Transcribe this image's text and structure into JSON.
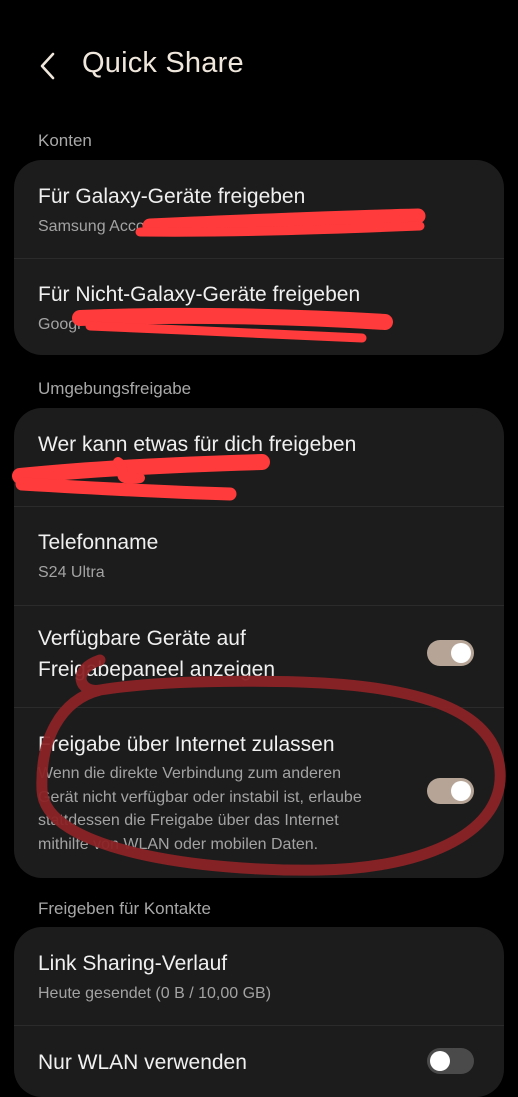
{
  "header": {
    "title": "Quick Share",
    "back_icon": "chevron-left-icon"
  },
  "sections": {
    "accounts": {
      "label": "Konten",
      "galaxy": {
        "title": "Für Galaxy-Geräte freigeben",
        "subtitle": "Samsung Acco"
      },
      "non_galaxy": {
        "title": "Für Nicht-Galaxy-Geräte freigeben",
        "subtitle": "Googl"
      }
    },
    "nearby": {
      "label": "Umgebungsfreigabe",
      "who": {
        "title": "Wer kann etwas für dich freigeben"
      },
      "phone_name": {
        "title": "Telefonname",
        "value": "S24 Ultra"
      },
      "show_devices": {
        "title_line1": "Verfügbare Geräte auf",
        "title_line2": "Freigabepaneel anzeigen",
        "toggle": "on"
      },
      "internet": {
        "title": "Freigabe über Internet zulassen",
        "desc_line1": "Wenn die direkte Verbindung zum anderen",
        "desc_line2": "Gerät nicht verfügbar oder instabil ist, erlaube",
        "desc_line3": "stattdessen die Freigabe über das Internet",
        "desc_line4": "mithilfe von WLAN oder mobilen Daten.",
        "toggle": "on"
      }
    },
    "contacts": {
      "label": "Freigeben für Kontakte",
      "link_sharing": {
        "title": "Link Sharing-Verlauf",
        "subtitle": "Heute gesendet (0 B / 10,00 GB)"
      },
      "wifi_only": {
        "title": "Nur WLAN verwenden",
        "toggle": "off"
      }
    }
  },
  "colors": {
    "background": "#000000",
    "card": "#1c1c1c",
    "toggle_on": "#b6a597",
    "toggle_off": "#4a4a4a",
    "redaction": "#ff3b3b",
    "circle_annotation": "#8a2326"
  }
}
